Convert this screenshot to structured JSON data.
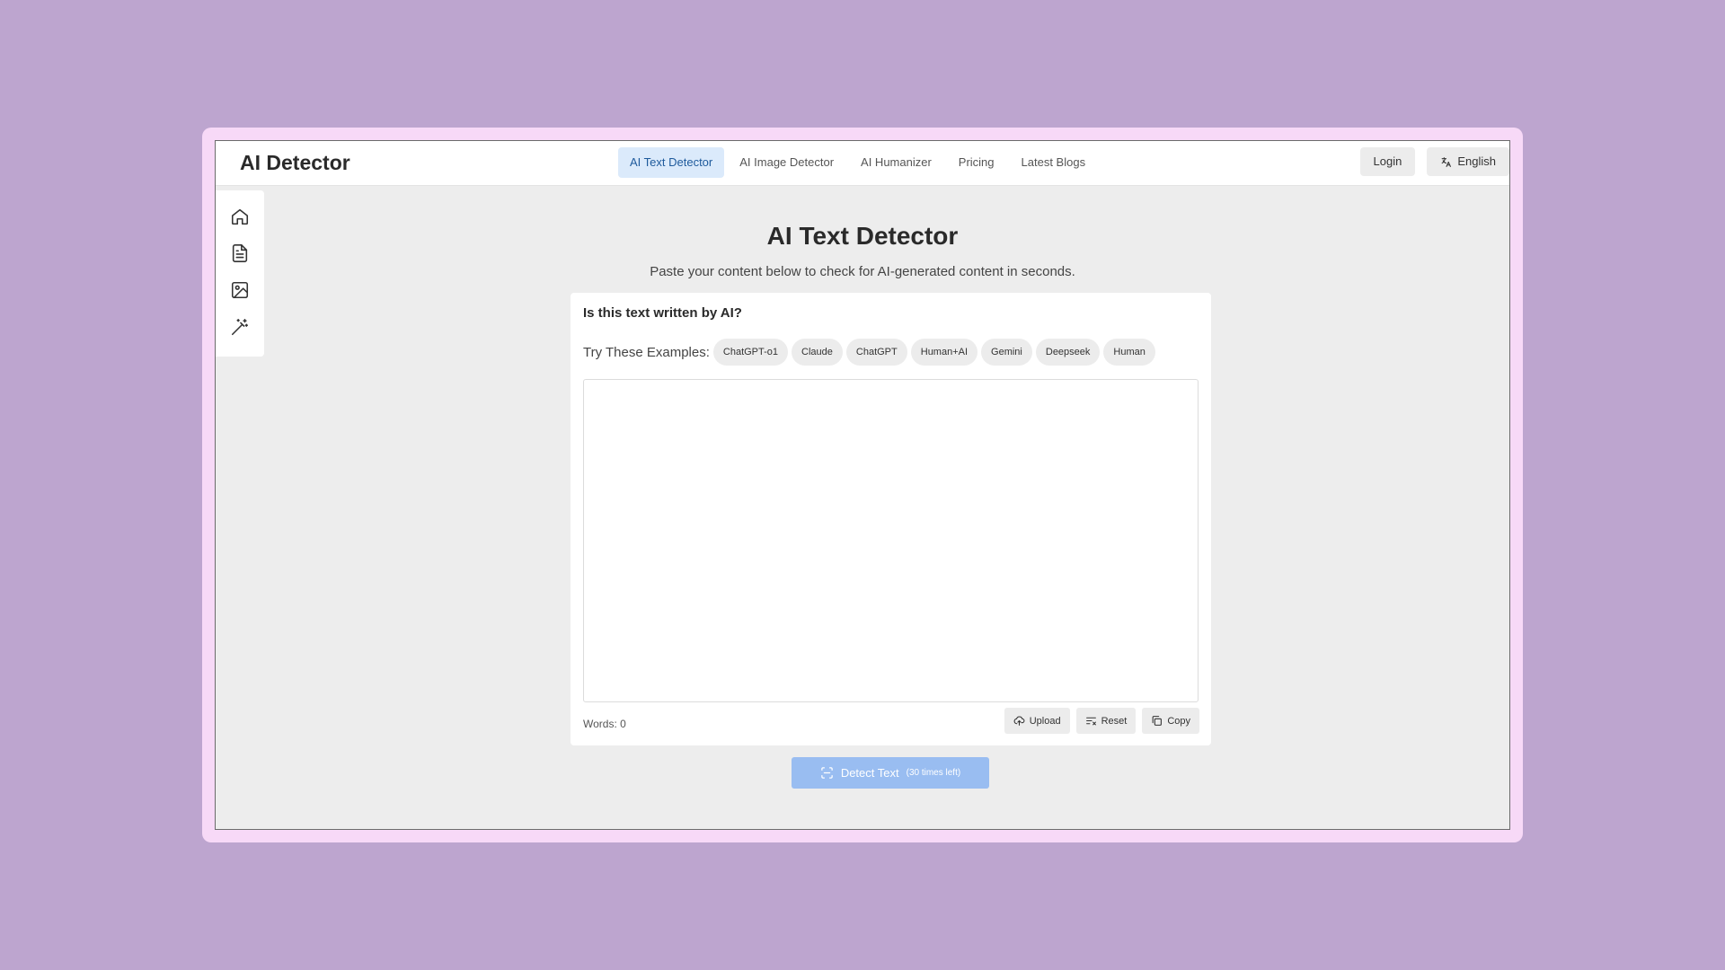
{
  "app": {
    "title": "AI Detector"
  },
  "nav": {
    "tabs": [
      {
        "label": "AI Text Detector",
        "active": true
      },
      {
        "label": "AI Image Detector"
      },
      {
        "label": "AI Humanizer"
      },
      {
        "label": "Pricing"
      },
      {
        "label": "Latest Blogs"
      }
    ]
  },
  "auth": {
    "login_label": "Login",
    "language_label": "English"
  },
  "sidebar": {
    "items": [
      {
        "icon": "home-icon"
      },
      {
        "icon": "document-icon"
      },
      {
        "icon": "image-icon"
      },
      {
        "icon": "magic-wand-icon"
      }
    ]
  },
  "main": {
    "title": "AI Text Detector",
    "subtitle": "Paste your content below to check for AI-generated content in seconds."
  },
  "card": {
    "question": "Is this text written by AI?",
    "examples_label": "Try These Examples:",
    "examples": [
      "ChatGPT-o1",
      "Claude",
      "ChatGPT",
      "Human+AI",
      "Gemini",
      "Deepseek",
      "Human"
    ],
    "textarea_value": "",
    "word_count": "Words: 0",
    "upload_label": "Upload",
    "reset_label": "Reset",
    "copy_label": "Copy"
  },
  "detect": {
    "label": "Detect Text",
    "sublabel": "(30 times left)"
  },
  "colors": {
    "background": "#bda5cf",
    "frame": "#f7d9f7",
    "accent_tab": "#dbeafb",
    "detect_button": "#99bdf1"
  }
}
